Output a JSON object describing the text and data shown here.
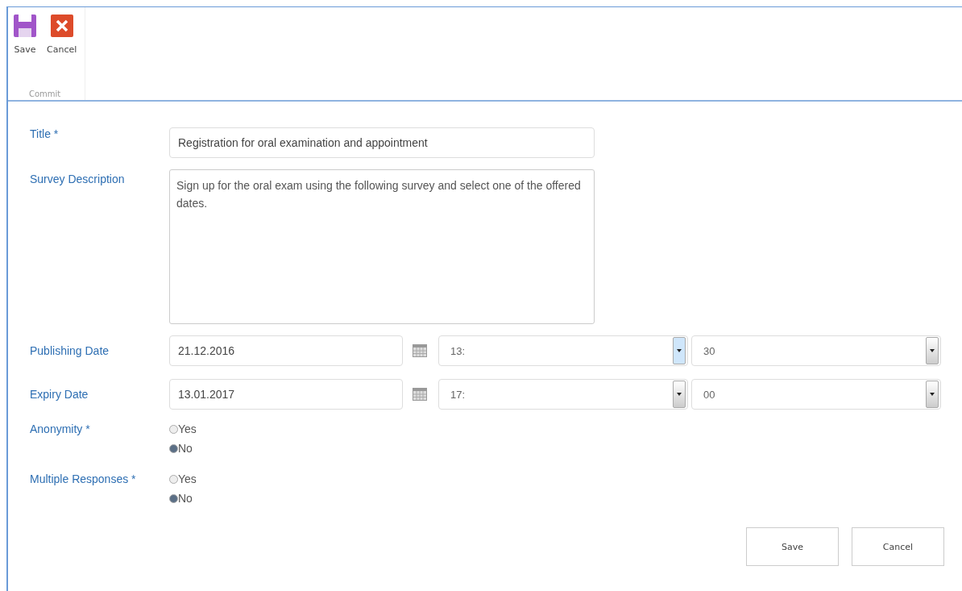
{
  "ribbon": {
    "buttons": [
      {
        "kind": "save",
        "label": "Save"
      },
      {
        "kind": "cancel",
        "label": "Cancel"
      }
    ],
    "group_label": "Commit"
  },
  "form": {
    "title": {
      "label": "Title *",
      "value": "Registration for oral examination and appointment"
    },
    "description": {
      "label": "Survey Description",
      "value": "Sign up for the oral exam using the following survey and select one of the offered dates."
    },
    "dates": [
      {
        "label": "Publishing Date",
        "date": "21.12.2016",
        "hour": "13:",
        "hour_highlighted": true,
        "minute": "30"
      },
      {
        "label": "Expiry Date",
        "date": "13.01.2017",
        "hour": "17:",
        "hour_highlighted": false,
        "minute": "00"
      }
    ],
    "choices": [
      {
        "label": "Anonymity *",
        "options": [
          {
            "label": "Yes",
            "selected": false
          },
          {
            "label": "No",
            "selected": true
          }
        ]
      },
      {
        "label": "Multiple Responses *",
        "options": [
          {
            "label": "Yes",
            "selected": false
          },
          {
            "label": "No",
            "selected": true
          }
        ]
      }
    ],
    "buttons": [
      "Save",
      "Cancel"
    ]
  }
}
